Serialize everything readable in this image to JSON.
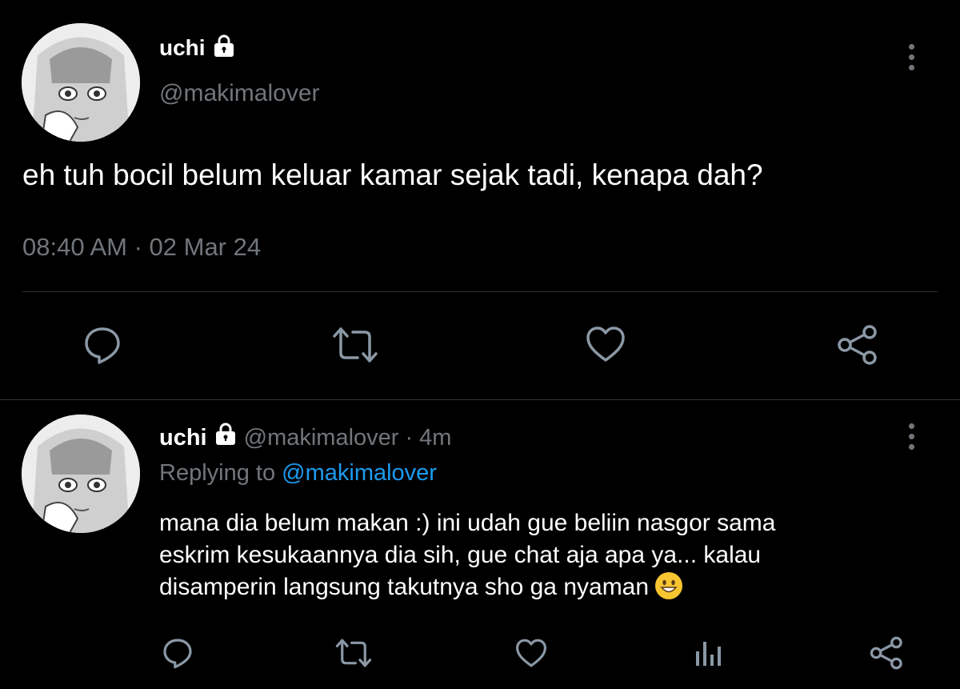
{
  "tweet": {
    "author_name": "uchi",
    "author_handle": "@makimalover",
    "text": "eh tuh bocil belum keluar kamar sejak tadi, kenapa dah?",
    "timestamp": "08:40 AM · 02 Mar 24",
    "icons": [
      "lock-icon",
      "more-icon",
      "reply-icon",
      "retweet-icon",
      "like-icon",
      "share-icon"
    ]
  },
  "reply": {
    "author_name": "uchi",
    "author_handle": "@makimalover",
    "separator": "·",
    "time_ago": "4m",
    "replying_to_label": "Replying to",
    "replying_to_handle": "@makimalover",
    "text_lines": [
      "mana dia belum makan :) ini udah gue beliin nasgor sama",
      "eskrim kesukaannya dia sih, gue chat aja apa ya... kalau",
      "disamperin langsung takutnya sho ga nyaman"
    ],
    "emoji": "grinning-face",
    "icons": [
      "reply-icon",
      "retweet-icon",
      "like-icon",
      "analytics-icon",
      "share-icon"
    ]
  },
  "colors": {
    "background": "#000000",
    "text": "#ffffff",
    "muted": "#71767b",
    "link": "#1d9bf0",
    "divider": "#2f3336"
  }
}
